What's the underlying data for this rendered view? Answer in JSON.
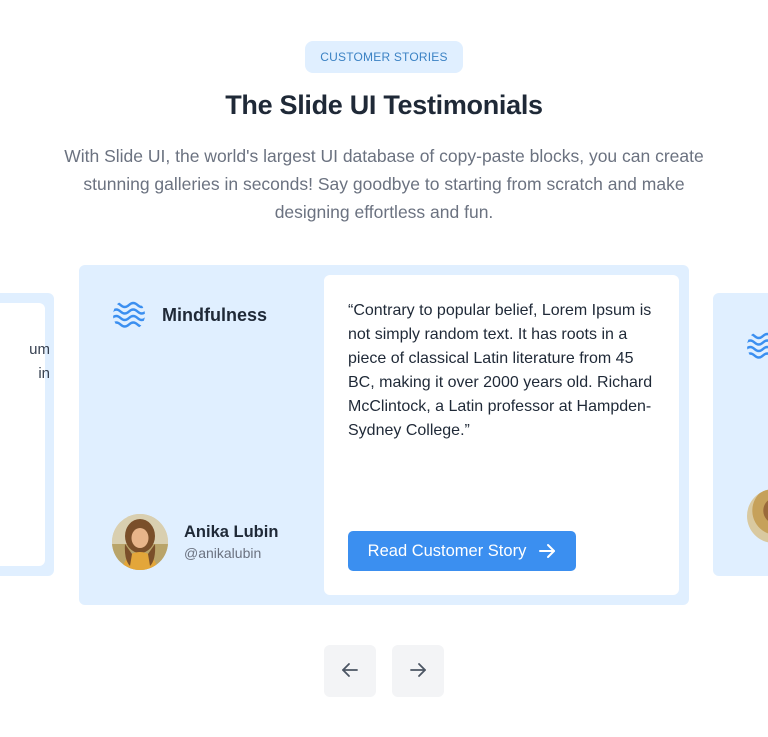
{
  "header": {
    "badge": "CUSTOMER STORIES",
    "title": "The Slide UI Testimonials",
    "description": "With Slide UI, the world's largest UI database of copy-paste blocks, you can create stunning galleries in seconds! Say goodbye to starting from scratch and make designing effortless and fun."
  },
  "left_card": {
    "fragment_line_1": "um",
    "fragment_line_2": "in"
  },
  "testimonial": {
    "brand_name": "Mindfulness",
    "brand_icon": "waves-icon",
    "quote": "“Contrary to popular belief, Lorem Ipsum is not simply random text. It has roots in a piece of classical Latin literature from 45 BC, making it over 2000 years old. Richard McClintock, a Latin professor at Hampden-Sydney College.”",
    "author_name": "Anika Lubin",
    "author_handle": "@anikalubin",
    "cta_label": "Read Customer Story",
    "cta_icon": "arrow-right-icon"
  },
  "navigation": {
    "prev_icon": "arrow-left-icon",
    "next_icon": "arrow-right-icon"
  },
  "colors": {
    "card_background": "#e0efff",
    "accent": "#3b8ff0",
    "badge_text": "#3b82c4"
  }
}
